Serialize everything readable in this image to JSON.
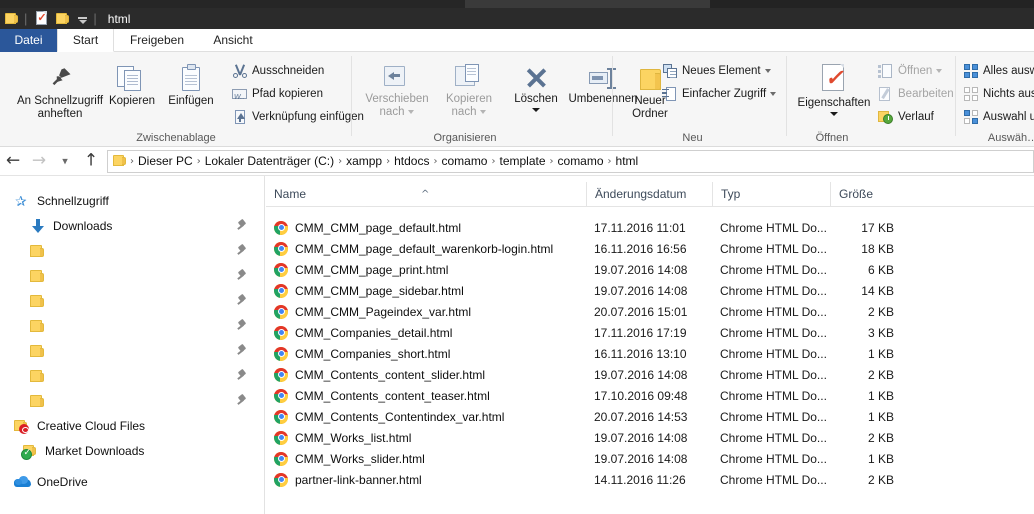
{
  "window": {
    "title": "html",
    "quick_access_icons": [
      "folder-icon",
      "properties-check-icon",
      "folder-icon",
      "customize-chevron-icon"
    ]
  },
  "ribbon": {
    "tabs": [
      {
        "label": "Datei",
        "active": false,
        "style": "file"
      },
      {
        "label": "Start",
        "active": true
      },
      {
        "label": "Freigeben",
        "active": false
      },
      {
        "label": "Ansicht",
        "active": false
      }
    ],
    "groups": [
      {
        "name": "Zwischenablage",
        "label": "Zwischenablage",
        "big_buttons": [
          {
            "label_line1": "An Schnellzugriff",
            "label_line2": "anheften",
            "icon": "pin-icon",
            "disabled": false
          },
          {
            "label_line1": "Kopieren",
            "label_line2": "",
            "icon": "copy-icon",
            "disabled": false
          },
          {
            "label_line1": "Einfügen",
            "label_line2": "",
            "icon": "paste-icon",
            "disabled": false
          }
        ],
        "small_buttons": [
          {
            "label": "Ausschneiden",
            "icon": "scissors-icon",
            "disabled": false
          },
          {
            "label": "Pfad kopieren",
            "icon": "copy-path-icon",
            "disabled": false
          },
          {
            "label": "Verknüpfung einfügen",
            "icon": "paste-shortcut-icon",
            "disabled": false
          }
        ]
      },
      {
        "name": "Organisieren",
        "label": "Organisieren",
        "big_buttons": [
          {
            "label_line1": "Verschieben",
            "label_line2": "nach",
            "icon": "move-to-icon",
            "disabled": true,
            "caret": "inline"
          },
          {
            "label_line1": "Kopieren",
            "label_line2": "nach",
            "icon": "copy-to-icon",
            "disabled": true,
            "caret": "inline"
          },
          {
            "label_line1": "Löschen",
            "label_line2": "",
            "icon": "delete-icon",
            "disabled": false,
            "caret": "below"
          },
          {
            "label_line1": "Umbenennen",
            "label_line2": "",
            "icon": "rename-icon",
            "disabled": false
          }
        ],
        "small_buttons": []
      },
      {
        "name": "Neu",
        "label": "Neu",
        "big_buttons": [
          {
            "label_line1": "Neuer",
            "label_line2": "Ordner",
            "icon": "new-folder-icon",
            "disabled": false
          }
        ],
        "small_buttons": [
          {
            "label": "Neues Element",
            "icon": "new-item-icon",
            "disabled": false,
            "caret": true
          },
          {
            "label": "Einfacher Zugriff",
            "icon": "easy-access-icon",
            "disabled": false,
            "caret": true
          }
        ]
      },
      {
        "name": "Öffnen",
        "label": "Öffnen",
        "big_buttons": [
          {
            "label_line1": "Eigenschaften",
            "label_line2": "",
            "icon": "properties-icon",
            "disabled": false,
            "caret": "below"
          }
        ],
        "small_buttons": [
          {
            "label": "Öffnen",
            "icon": "open-icon",
            "disabled": true,
            "caret": true
          },
          {
            "label": "Bearbeiten",
            "icon": "edit-icon",
            "disabled": true
          },
          {
            "label": "Verlauf",
            "icon": "history-icon",
            "disabled": false
          }
        ]
      },
      {
        "name": "Auswählen",
        "label": "Auswäh…",
        "big_buttons": [],
        "small_buttons": [
          {
            "label": "Alles ausw…",
            "icon": "select-all-icon",
            "disabled": false
          },
          {
            "label": "Nichts aus…",
            "icon": "select-none-icon",
            "disabled": false
          },
          {
            "label": "Auswahl u…",
            "icon": "invert-selection-icon",
            "disabled": false
          }
        ]
      }
    ]
  },
  "address_bar": {
    "back": "back-arrow",
    "forward": "forward-arrow",
    "recent": "recent-chevron",
    "up": "up-arrow",
    "crumbs": [
      "Dieser PC",
      "Lokaler Datenträger (C:)",
      "xampp",
      "htdocs",
      "comamo",
      "template",
      "comamo",
      "html"
    ],
    "separator": "›"
  },
  "nav_pane": {
    "items": [
      {
        "label": "Schnellzugriff",
        "icon": "star-icon",
        "indent": 14,
        "pinned": false
      },
      {
        "label": "Downloads",
        "icon": "download-icon",
        "indent": 30,
        "pinned": true
      },
      {
        "label": "",
        "icon": "folder-icon",
        "indent": 30,
        "pinned": true
      },
      {
        "label": "",
        "icon": "folder-icon",
        "indent": 30,
        "pinned": true
      },
      {
        "label": "",
        "icon": "folder-icon",
        "indent": 30,
        "pinned": true
      },
      {
        "label": "",
        "icon": "folder-icon",
        "indent": 30,
        "pinned": true
      },
      {
        "label": "",
        "icon": "folder-icon",
        "indent": 30,
        "pinned": true
      },
      {
        "label": "",
        "icon": "folder-icon",
        "indent": 30,
        "pinned": true
      },
      {
        "label": "",
        "icon": "folder-icon",
        "indent": 30,
        "pinned": true
      },
      {
        "label": "Creative Cloud Files",
        "icon": "creative-cloud-icon",
        "indent": 14,
        "pinned": false
      },
      {
        "label": "Market Downloads",
        "icon": "market-downloads-icon",
        "indent": 22,
        "pinned": false
      },
      {
        "label": "OneDrive",
        "icon": "onedrive-icon",
        "indent": 14,
        "pinned": false
      }
    ]
  },
  "file_list": {
    "sort_column": "Name",
    "sort_direction": "ascending",
    "columns": [
      "Name",
      "Änderungsdatum",
      "Typ",
      "Größe"
    ],
    "rows": [
      {
        "name": "CMM_CMM_page_default.html",
        "date": "17.11.2016 11:01",
        "type": "Chrome HTML Do...",
        "size": "17 KB",
        "icon": "chrome-html-icon"
      },
      {
        "name": "CMM_CMM_page_default_warenkorb-login.html",
        "date": "16.11.2016 16:56",
        "type": "Chrome HTML Do...",
        "size": "18 KB",
        "icon": "chrome-html-icon"
      },
      {
        "name": "CMM_CMM_page_print.html",
        "date": "19.07.2016 14:08",
        "type": "Chrome HTML Do...",
        "size": "6 KB",
        "icon": "chrome-html-icon"
      },
      {
        "name": "CMM_CMM_page_sidebar.html",
        "date": "19.07.2016 14:08",
        "type": "Chrome HTML Do...",
        "size": "14 KB",
        "icon": "chrome-html-icon"
      },
      {
        "name": "CMM_CMM_Pageindex_var.html",
        "date": "20.07.2016 15:01",
        "type": "Chrome HTML Do...",
        "size": "2 KB",
        "icon": "chrome-html-icon"
      },
      {
        "name": "CMM_Companies_detail.html",
        "date": "17.11.2016 17:19",
        "type": "Chrome HTML Do...",
        "size": "3 KB",
        "icon": "chrome-html-icon"
      },
      {
        "name": "CMM_Companies_short.html",
        "date": "16.11.2016 13:10",
        "type": "Chrome HTML Do...",
        "size": "1 KB",
        "icon": "chrome-html-icon"
      },
      {
        "name": "CMM_Contents_content_slider.html",
        "date": "19.07.2016 14:08",
        "type": "Chrome HTML Do...",
        "size": "2 KB",
        "icon": "chrome-html-icon"
      },
      {
        "name": "CMM_Contents_content_teaser.html",
        "date": "17.10.2016 09:48",
        "type": "Chrome HTML Do...",
        "size": "1 KB",
        "icon": "chrome-html-icon"
      },
      {
        "name": "CMM_Contents_Contentindex_var.html",
        "date": "20.07.2016 14:53",
        "type": "Chrome HTML Do...",
        "size": "1 KB",
        "icon": "chrome-html-icon"
      },
      {
        "name": "CMM_Works_list.html",
        "date": "19.07.2016 14:08",
        "type": "Chrome HTML Do...",
        "size": "2 KB",
        "icon": "chrome-html-icon"
      },
      {
        "name": "CMM_Works_slider.html",
        "date": "19.07.2016 14:08",
        "type": "Chrome HTML Do...",
        "size": "1 KB",
        "icon": "chrome-html-icon"
      },
      {
        "name": "partner-link-banner.html",
        "date": "14.11.2016 11:26",
        "type": "Chrome HTML Do...",
        "size": "2 KB",
        "icon": "chrome-html-icon"
      }
    ]
  },
  "colors": {
    "titlebar": "#2b2b2b",
    "file_tab": "#2b579a",
    "ribbon_bg": "#f6f6f6",
    "folder_yellow": "#fcd462",
    "accent_blue": "#4a90d9"
  }
}
